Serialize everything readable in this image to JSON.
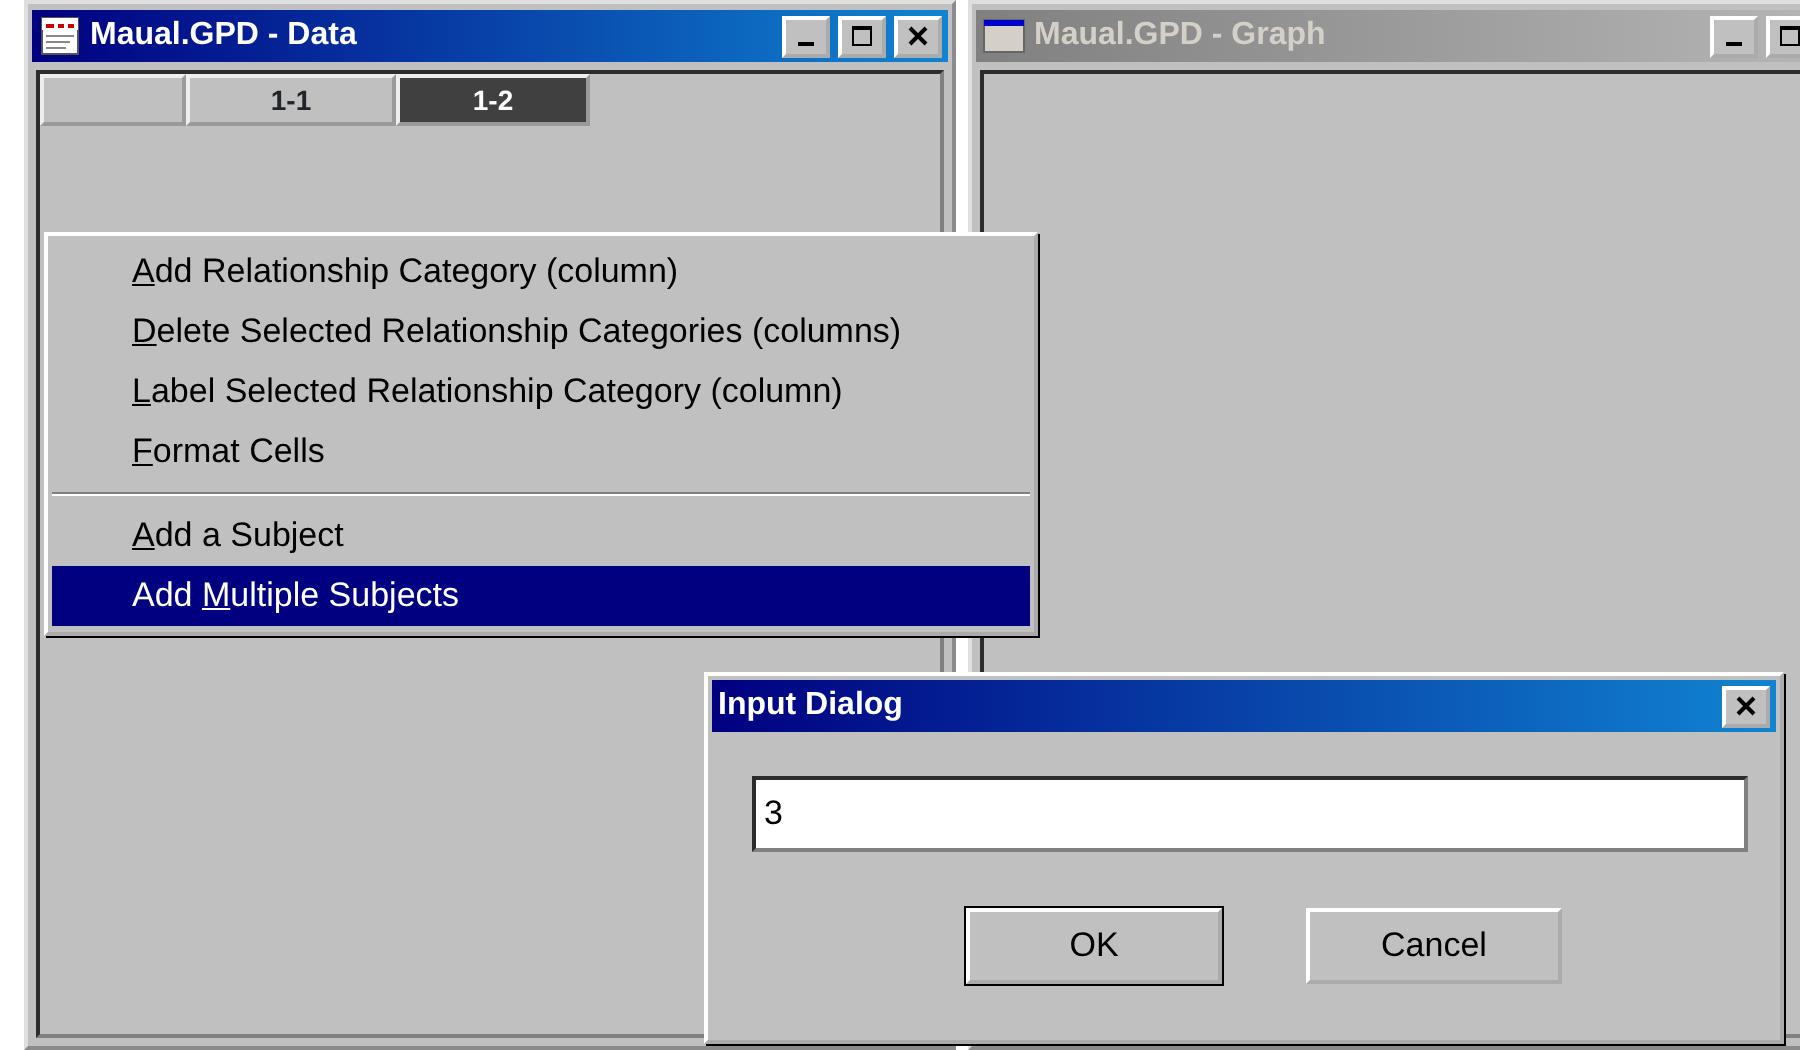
{
  "windows": [
    {
      "title": "Maual.GPD - Data",
      "active": true,
      "tabs": [
        {
          "selected": false
        },
        {
          "label": "1-1",
          "selected": false
        },
        {
          "label": "1-2",
          "selected": true
        }
      ]
    },
    {
      "title": "Maual.GPD - Graph",
      "active": false
    }
  ],
  "context_menu": {
    "items": [
      {
        "kind": "item",
        "access_key": "A",
        "label_end": "dd Relationship Category (column)",
        "selected": false
      },
      {
        "kind": "item",
        "access_key": "D",
        "label_end": "elete Selected Relationship Categories (columns)",
        "selected": false
      },
      {
        "kind": "item",
        "access_key": "L",
        "label_end": "abel Selected Relationship Category (column)",
        "selected": false
      },
      {
        "kind": "item",
        "access_key": "F",
        "label_end": "ormat Cells",
        "selected": false
      },
      {
        "kind": "separator"
      },
      {
        "kind": "item",
        "access_key": "A",
        "label_end": "dd a Subject",
        "selected": false
      },
      {
        "kind": "item",
        "label_start": "Add ",
        "access_key": "M",
        "label_end": "ultiple Subjects",
        "selected": true
      }
    ]
  },
  "dialog": {
    "title": "Input Dialog",
    "value": "3",
    "buttons": [
      {
        "label": "OK",
        "default": true
      },
      {
        "label": "Cancel",
        "default": false
      }
    ]
  }
}
